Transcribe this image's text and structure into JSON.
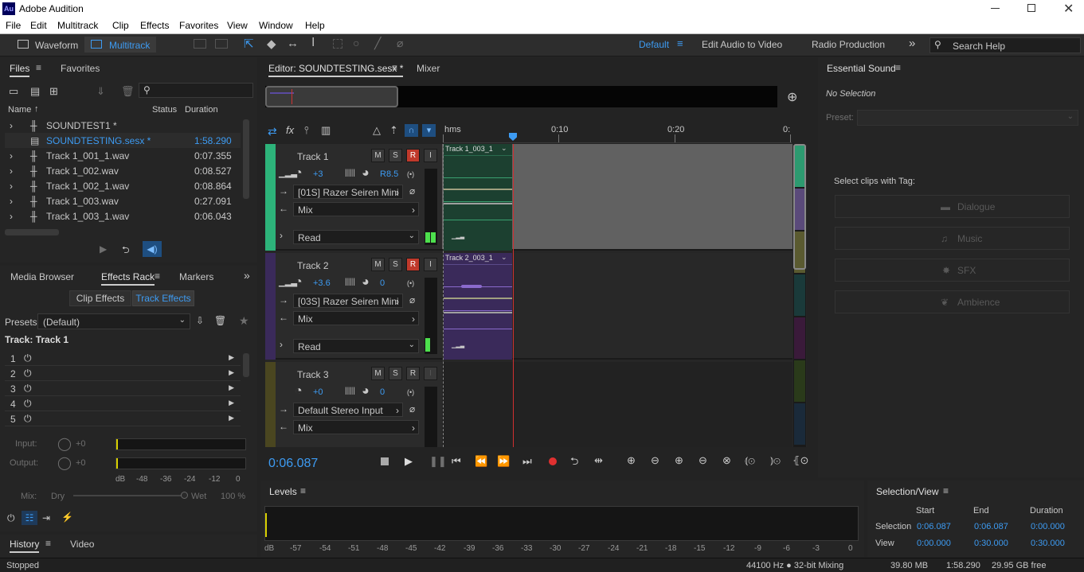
{
  "app": {
    "title": "Adobe Audition",
    "logo": "Au"
  },
  "menu": [
    "File",
    "Edit",
    "Multitrack",
    "Clip",
    "Effects",
    "Favorites",
    "View",
    "Window",
    "Help"
  ],
  "toolbar": {
    "waveform": "Waveform",
    "multitrack": "Multitrack",
    "workspaces": [
      "Default",
      "Edit Audio to Video",
      "Radio Production"
    ],
    "search_placeholder": "Search Help"
  },
  "files": {
    "tab_files": "Files",
    "tab_favorites": "Favorites",
    "col_name": "Name",
    "col_status": "Status",
    "col_duration": "Duration",
    "items": [
      {
        "name": "SOUNDTEST1 *",
        "duration": ""
      },
      {
        "name": "SOUNDTESTING.sesx *",
        "duration": "1:58.290"
      },
      {
        "name": "Track 1_001_1.wav",
        "duration": "0:07.355"
      },
      {
        "name": "Track 1_002.wav",
        "duration": "0:08.527"
      },
      {
        "name": "Track 1_002_1.wav",
        "duration": "0:08.864"
      },
      {
        "name": "Track 1_003.wav",
        "duration": "0:27.091"
      },
      {
        "name": "Track 1_003_1.wav",
        "duration": "0:06.043"
      }
    ]
  },
  "effects": {
    "tabs": [
      "Media Browser",
      "Effects Rack",
      "Markers"
    ],
    "sub_tabs": [
      "Clip Effects",
      "Track Effects"
    ],
    "presets_label": "Presets:",
    "presets_value": "(Default)",
    "track_label": "Track: Track 1",
    "slots": [
      "1",
      "2",
      "3",
      "4",
      "5"
    ],
    "input_label": "Input:",
    "output_label": "Output:",
    "input_val": "+0",
    "output_val": "+0",
    "scale": [
      "dB",
      "-48",
      "-36",
      "-24",
      "-12",
      "0"
    ],
    "mix_label": "Mix:",
    "dry": "Dry",
    "wet": "Wet",
    "pct": "100 %"
  },
  "history": {
    "tab_history": "History",
    "tab_video": "Video"
  },
  "editor": {
    "tab": "Editor: SOUNDTESTING.sesx *",
    "mixer": "Mixer",
    "ruler": [
      "hms",
      "0:10",
      "0:20",
      "0:"
    ],
    "time": "0:06.087",
    "tracks": [
      {
        "name": "Track 1",
        "vol": "+3",
        "pan": "R8.5",
        "input": "[01S] Razer Seiren Mini",
        "output": "Mix",
        "auto": "Read",
        "clip": "Track 1_003_1",
        "color": "#2db37a"
      },
      {
        "name": "Track 2",
        "vol": "+3.6",
        "pan": "0",
        "input": "[03S] Razer Seiren Mini",
        "output": "Mix",
        "auto": "Read",
        "clip": "Track 2_003_1",
        "color": "#7a4fb5"
      },
      {
        "name": "Track 3",
        "vol": "+0",
        "pan": "0",
        "input": "Default Stereo Input",
        "output": "Mix",
        "auto": "",
        "clip": "",
        "color": "#8a7a20"
      }
    ],
    "btn_m": "M",
    "btn_s": "S",
    "btn_r": "R",
    "btn_i": "I"
  },
  "essential": {
    "title": "Essential Sound",
    "no_sel": "No Selection",
    "preset": "Preset:",
    "select_tag": "Select clips with Tag:",
    "tags": [
      "Dialogue",
      "Music",
      "SFX",
      "Ambience"
    ]
  },
  "levels": {
    "title": "Levels",
    "scale": [
      "dB",
      "-57",
      "-54",
      "-51",
      "-48",
      "-45",
      "-42",
      "-39",
      "-36",
      "-33",
      "-30",
      "-27",
      "-24",
      "-21",
      "-18",
      "-15",
      "-12",
      "-9",
      "-6",
      "-3",
      "0"
    ]
  },
  "selview": {
    "title": "Selection/View",
    "cols": [
      "Start",
      "End",
      "Duration"
    ],
    "rows": [
      {
        "label": "Selection",
        "start": "0:06.087",
        "end": "0:06.087",
        "dur": "0:00.000"
      },
      {
        "label": "View",
        "start": "0:00.000",
        "end": "0:30.000",
        "dur": "0:30.000"
      }
    ]
  },
  "status": {
    "left": "Stopped",
    "rate": "44100 Hz ● 32-bit Mixing",
    "mem": "39.80 MB",
    "dur": "1:58.290",
    "free": "29.95 GB free"
  },
  "colors": {
    "accent": "#3d9bf2",
    "record": "#c0392b",
    "playhead": "#d03030"
  }
}
